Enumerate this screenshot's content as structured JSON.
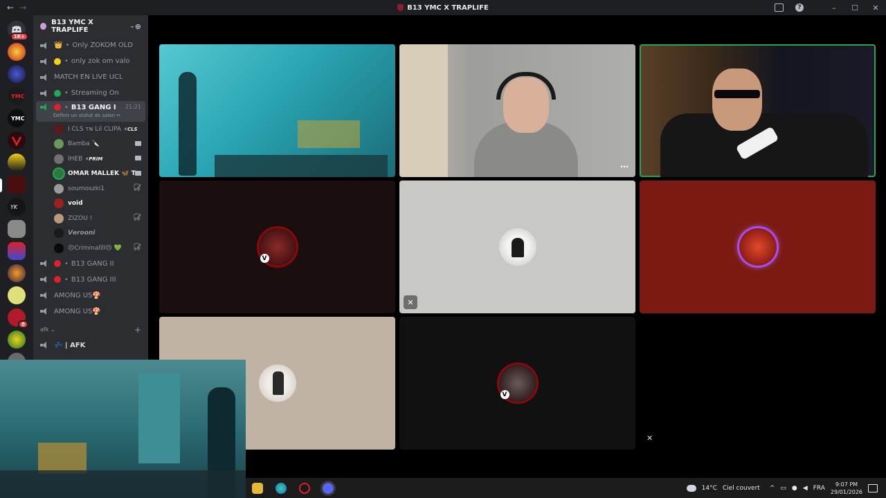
{
  "window": {
    "title": "B13 YMC X TRAPLIFE",
    "minimize": "–",
    "maximize": "☐",
    "close": "✕",
    "help": "?"
  },
  "rail": {
    "home_badge": "1K+",
    "folder_badge": "8"
  },
  "guild": {
    "name": "B13 YMC X TRAPLIFE",
    "chevron": "⌄",
    "invite": "⊕"
  },
  "channels": [
    {
      "emoji": "👑",
      "name": "Only ZOKOM OLD"
    },
    {
      "name": "only zok om valo",
      "dot": "#f0d01a"
    },
    {
      "name": "MATCH EN LIVE UCL"
    },
    {
      "name": "Streaming On",
      "dot": "#23a55a"
    }
  ],
  "active_channel": {
    "name": "B13 GANG I",
    "dot": "#e0212b",
    "timer": "21:21",
    "status": "Définir un statut de salon ✏"
  },
  "voice_users": [
    {
      "name": "I CLS ᴛɴ Lil CLIPA",
      "tag": "⚡CLS",
      "avatar": "#5a1a1a"
    },
    {
      "name": "Bamba 🔪",
      "avatar": "#6a9a5a",
      "camera": true
    },
    {
      "name": "IHEB",
      "tag": "⚡PRIM",
      "avatar": "#707070",
      "camera": true
    },
    {
      "name": "OMAR MALLEK 🦋 T",
      "avatar": "#2b7a3b",
      "camera": true,
      "bold": true
    },
    {
      "name": "soumoszki1",
      "avatar": "#9a9a9a",
      "deaf": true
    },
    {
      "name": "void",
      "avatar": "#a0201e",
      "bold": true
    },
    {
      "name": "ZIZOU !",
      "avatar": "#b89a7a",
      "deaf": true
    },
    {
      "name": "𝙑𝙚𝙧𝙤𝙤𝙣𝙞",
      "avatar": "#1a1a1a"
    },
    {
      "name": "😣Criminallll😣 💚",
      "avatar": "#0a0a0a",
      "deaf": true
    }
  ],
  "channels_after": [
    {
      "name": "B13 GANG II",
      "dot": "#e0212b"
    },
    {
      "name": "B13 GANG III",
      "dot": "#e0212b"
    },
    {
      "name": "AMONG US🍄"
    },
    {
      "name": "AMONG US🍄"
    }
  ],
  "category": {
    "name": "afk ⌄",
    "add": "+"
  },
  "afk_channel": {
    "name": "💤 | AFK"
  },
  "tiles": [
    {
      "kind": "video",
      "color": "#3ab7c4"
    },
    {
      "kind": "video",
      "color": "#b9b9b6"
    },
    {
      "kind": "video",
      "color": "#2e2418",
      "speaking": true
    },
    {
      "kind": "avatar",
      "bg": "#1a0e0e",
      "avatar": "#4a1010",
      "v_badge": "V"
    },
    {
      "kind": "avatar",
      "bg": "#c8c8c4",
      "avatar": "#e6e6e2",
      "muted": true
    },
    {
      "kind": "avatar",
      "bg": "#7a1a12",
      "avatar": "#b02a1a",
      "ring": "#a64dff"
    },
    {
      "kind": "avatar",
      "bg": "#c0b3a4",
      "avatar": "#e8e4e0"
    },
    {
      "kind": "avatar",
      "bg": "#111111",
      "avatar": "#3a0a0a",
      "v_badge": "V"
    },
    {
      "kind": "empty",
      "bg": "#000000"
    }
  ],
  "icons": {
    "deafened": "🎧̸",
    "more": "⋯",
    "muted": "✕"
  },
  "taskbar": {
    "temperature": "14°C",
    "weather": "Ciel couvert",
    "language": "FRA",
    "time": "9:07 PM",
    "date": "29/01/2026",
    "tray_chevron": "^"
  }
}
